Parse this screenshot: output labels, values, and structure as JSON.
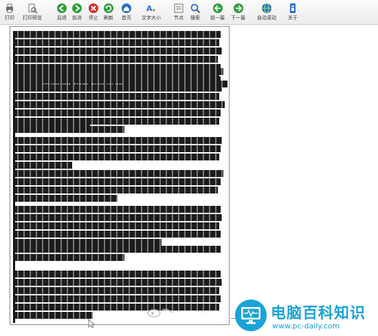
{
  "toolbar": {
    "buttons": [
      {
        "name": "print",
        "label": "打印",
        "icon": "printer-icon",
        "color": "#6b6b6b"
      },
      {
        "name": "print-preview",
        "label": "打印预览",
        "icon": "print-preview-icon",
        "color": "#6b6b6b"
      },
      {
        "name": "back",
        "label": "后退",
        "icon": "back-arrow-icon",
        "color": "#2e9e3a"
      },
      {
        "name": "forward",
        "label": "前进",
        "icon": "forward-arrow-icon",
        "color": "#2e9e3a"
      },
      {
        "name": "stop",
        "label": "停止",
        "icon": "stop-icon",
        "color": "#d92b2b"
      },
      {
        "name": "refresh",
        "label": "刷新",
        "icon": "refresh-icon",
        "color": "#2e9e3a"
      },
      {
        "name": "home",
        "label": "首页",
        "icon": "home-icon",
        "color": "#2a6fcf"
      },
      {
        "name": "text-size",
        "label": "文字大小",
        "icon": "text-size-icon",
        "color": "#2a6fcf"
      },
      {
        "name": "section",
        "label": "节点",
        "icon": "section-icon",
        "color": "#6b6b6b"
      },
      {
        "name": "search",
        "label": "搜索",
        "icon": "search-icon",
        "color": "#2a6fcf"
      },
      {
        "name": "prev",
        "label": "前一篇",
        "icon": "prev-arrow-icon",
        "color": "#2e9e3a"
      },
      {
        "name": "next",
        "label": "下一篇",
        "icon": "next-arrow-icon",
        "color": "#2e9e3a"
      },
      {
        "name": "auto-scroll",
        "label": "自动滚动",
        "icon": "globe-icon",
        "color": "#2a6fcf"
      },
      {
        "name": "about",
        "label": "关于",
        "icon": "about-icon",
        "color": "#2a6fcf"
      }
    ]
  },
  "document": {
    "paragraphs": [
      {
        "lines": [
          "",
          "",
          "",
          "",
          "",
          "",
          ""
        ],
        "inline_text": "Technology Forms Association"
      },
      {
        "lines": [
          "",
          "",
          "",
          "",
          "",
          "",
          "",
          ""
        ],
        "inline_text": ""
      },
      {
        "lines": [
          ""
        ],
        "inline_text": ""
      },
      {
        "lines": [
          "",
          "",
          "",
          ""
        ],
        "inline_text": ""
      },
      {
        "lines": [
          "",
          "",
          "",
          ""
        ],
        "inline_text": ""
      },
      {
        "lines": [
          "",
          "",
          "",
          "",
          ""
        ],
        "inline_text": ""
      },
      {
        "lines": [
          "",
          ""
        ],
        "inline_text": ""
      },
      {
        "lines": [
          "",
          "",
          "",
          "",
          "",
          ""
        ],
        "inline_text": ""
      }
    ]
  },
  "brand": {
    "name": "电脑百科知识",
    "url": "www.pc-daily.com",
    "color": "#1aa3d8"
  }
}
